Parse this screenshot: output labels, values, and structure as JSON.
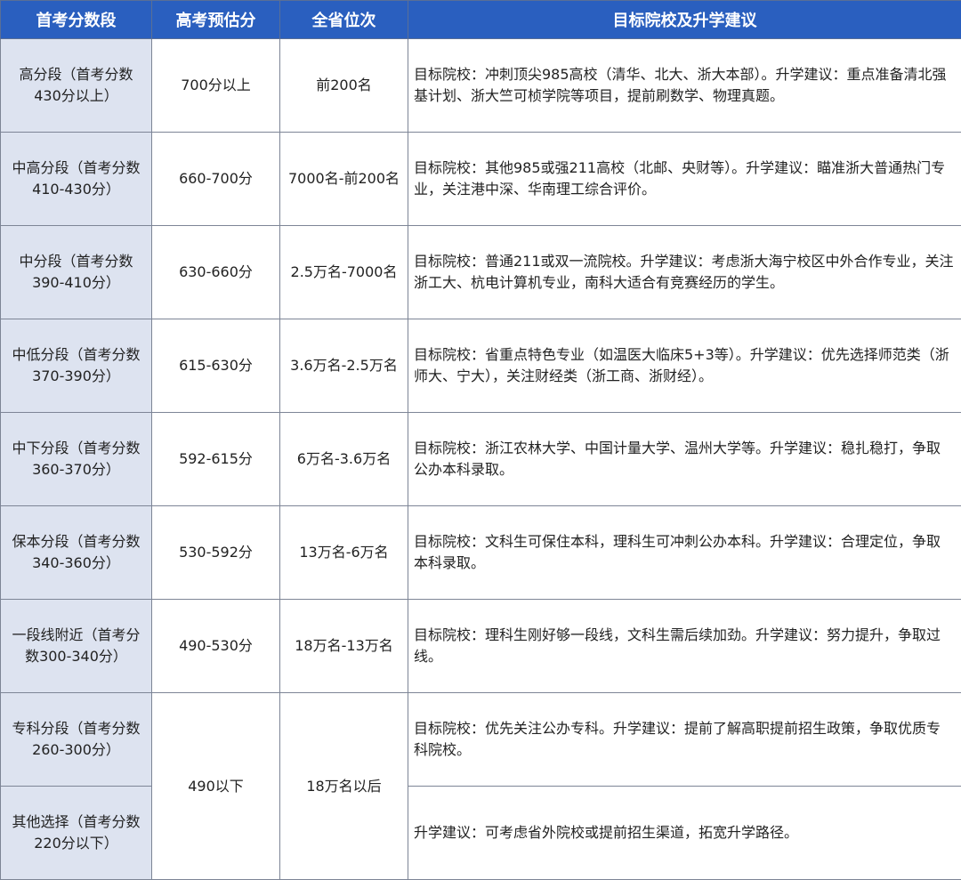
{
  "headers": [
    "首考分数段",
    "高考预估分",
    "全省位次",
    "目标院校及升学建议"
  ],
  "rows": [
    {
      "band": "高分段（首考分数430分以上）",
      "score": "700分以上",
      "rank": "前200名",
      "advice": "目标院校：冲刺顶尖985高校（清华、北大、浙大本部）。升学建议：重点准备清北强基计划、浙大竺可桢学院等项目，提前刷数学、物理真题。"
    },
    {
      "band": "中高分段（首考分数410-430分）",
      "score": "660-700分",
      "rank": "7000名-前200名",
      "advice": "目标院校：其他985或强211高校（北邮、央财等）。升学建议：瞄准浙大普通热门专业，关注港中深、华南理工综合评价。"
    },
    {
      "band": "中分段（首考分数390-410分）",
      "score": "630-660分",
      "rank": "2.5万名-7000名",
      "advice": "目标院校：普通211或双一流院校。升学建议：考虑浙大海宁校区中外合作专业，关注浙工大、杭电计算机专业，南科大适合有竞赛经历的学生。"
    },
    {
      "band": "中低分段（首考分数370-390分）",
      "score": "615-630分",
      "rank": "3.6万名-2.5万名",
      "advice": "目标院校：省重点特色专业（如温医大临床5+3等）。升学建议：优先选择师范类（浙师大、宁大），关注财经类（浙工商、浙财经）。"
    },
    {
      "band": "中下分段（首考分数360-370分）",
      "score": "592-615分",
      "rank": "6万名-3.6万名",
      "advice": "目标院校：浙江农林大学、中国计量大学、温州大学等。升学建议：稳扎稳打，争取公办本科录取。"
    },
    {
      "band": "保本分段（首考分数340-360分）",
      "score": "530-592分",
      "rank": "13万名-6万名",
      "advice": "目标院校：文科生可保住本科，理科生可冲刺公办本科。升学建议：合理定位，争取本科录取。"
    },
    {
      "band": "一段线附近（首考分数300-340分）",
      "score": "490-530分",
      "rank": "18万名-13万名",
      "advice": "目标院校：理科生刚好够一段线，文科生需后续加劲。升学建议：努力提升，争取过线。"
    },
    {
      "band": "专科分段（首考分数260-300分）",
      "score": "490以下",
      "rank": "18万名以后",
      "advice": "目标院校：优先关注公办专科。升学建议：提前了解高职提前招生政策，争取优质专科院校。"
    },
    {
      "band": "其他选择（首考分数220分以下）",
      "advice": "升学建议：可考虑省外院校或提前招生渠道，拓宽升学路径。"
    }
  ],
  "colors": {
    "header_bg": "#2a5fbf",
    "band_bg": "#dde3f0",
    "border": "#7d8596"
  }
}
